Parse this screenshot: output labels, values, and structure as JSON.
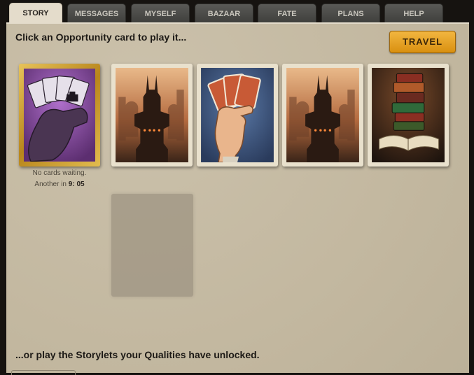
{
  "tabs": [
    {
      "label": "STORY",
      "active": true
    },
    {
      "label": "MESSAGES",
      "active": false
    },
    {
      "label": "MYSELF",
      "active": false
    },
    {
      "label": "BAZAAR",
      "active": false
    },
    {
      "label": "FATE",
      "active": false
    },
    {
      "label": "PLANS",
      "active": false
    },
    {
      "label": "HELP",
      "active": false
    }
  ],
  "main": {
    "heading": "Click an Opportunity card to play it...",
    "travel_label": "TRAVEL",
    "deck": {
      "status": "No cards waiting.",
      "timer_prefix": "Another in",
      "timer_value": "9: 05"
    },
    "cards": [
      {
        "icon": "city-skyline-icon"
      },
      {
        "icon": "hand-of-cards-icon"
      },
      {
        "icon": "city-skyline-icon"
      },
      {
        "icon": "book-stack-icon"
      }
    ],
    "storylets_heading": "...or play the Storylets your Qualities have unlocked."
  },
  "colors": {
    "accent": "#e8a52a",
    "panel_bg": "#c6bba4",
    "tab_bg": "#4a4a47",
    "tab_active_bg": "#e4dccb"
  }
}
